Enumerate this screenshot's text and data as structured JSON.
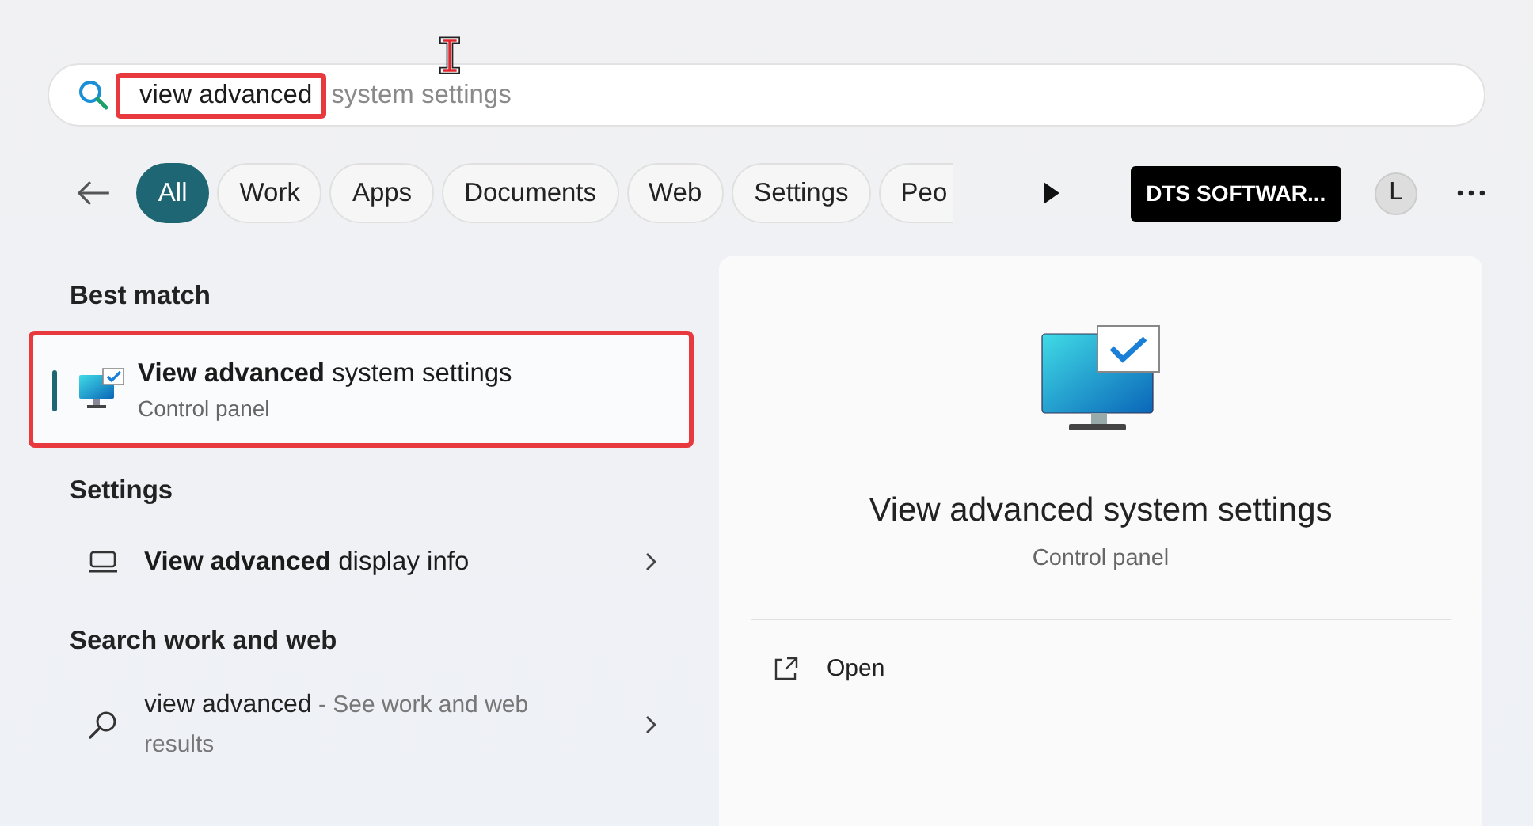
{
  "search": {
    "value": "view advanced",
    "completion": "system settings",
    "highlighted": true
  },
  "filters": [
    {
      "label": "All",
      "selected": true
    },
    {
      "label": "Work",
      "selected": false
    },
    {
      "label": "Apps",
      "selected": false
    },
    {
      "label": "Documents",
      "selected": false
    },
    {
      "label": "Web",
      "selected": false
    },
    {
      "label": "Settings",
      "selected": false
    },
    {
      "label": "Peo",
      "selected": false
    }
  ],
  "organization": "DTS SOFTWAR...",
  "account": {
    "initial": "L"
  },
  "sections": [
    {
      "heading": "Best match",
      "items": [
        {
          "kind": "app",
          "title": "**View advanced** system settings",
          "subtitle": "Control panel",
          "selected": true,
          "highlighted": true
        }
      ]
    },
    {
      "heading": "Settings",
      "items": [
        {
          "kind": "setting",
          "title": "**View advanced** display info",
          "selected": false,
          "highlighted": false
        }
      ]
    },
    {
      "heading": "Search work and web",
      "items": [
        {
          "kind": "web",
          "query": "view advanced",
          "hint": "- See work and web results",
          "selected": false,
          "highlighted": false
        }
      ]
    }
  ],
  "preview": {
    "title": "View advanced system settings",
    "subtitle": "Control panel",
    "actions": [
      {
        "label": "Open"
      }
    ]
  }
}
